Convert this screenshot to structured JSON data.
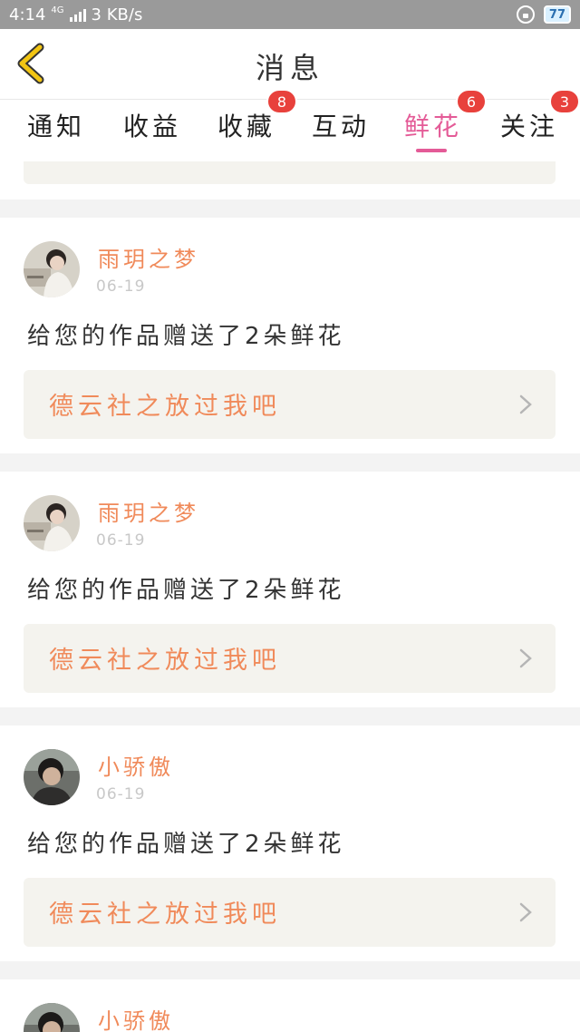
{
  "status_bar": {
    "time": "4:14",
    "network": "4G",
    "speed": "3 KB/s",
    "battery": "77"
  },
  "header": {
    "title": "消息"
  },
  "tabs": [
    {
      "label": "通知",
      "badge": ""
    },
    {
      "label": "收益",
      "badge": ""
    },
    {
      "label": "收藏",
      "badge": "8"
    },
    {
      "label": "互动",
      "badge": ""
    },
    {
      "label": "鲜花",
      "badge": "6",
      "active": true
    },
    {
      "label": "关注",
      "badge": "3"
    }
  ],
  "feed": [
    {
      "user": "雨玥之梦",
      "date": "06-19",
      "message": "给您的作品赠送了2朵鲜花",
      "work": "德云社之放过我吧"
    },
    {
      "user": "雨玥之梦",
      "date": "06-19",
      "message": "给您的作品赠送了2朵鲜花",
      "work": "德云社之放过我吧"
    },
    {
      "user": "小骄傲",
      "date": "06-19",
      "message": "给您的作品赠送了2朵鲜花",
      "work": "德云社之放过我吧"
    },
    {
      "user": "小骄傲"
    }
  ],
  "colors": {
    "accent_pink": "#e45b97",
    "username_orange": "#f08a5a",
    "badge_red": "#e8413c",
    "back_arrow_yellow": "#f2c513"
  }
}
